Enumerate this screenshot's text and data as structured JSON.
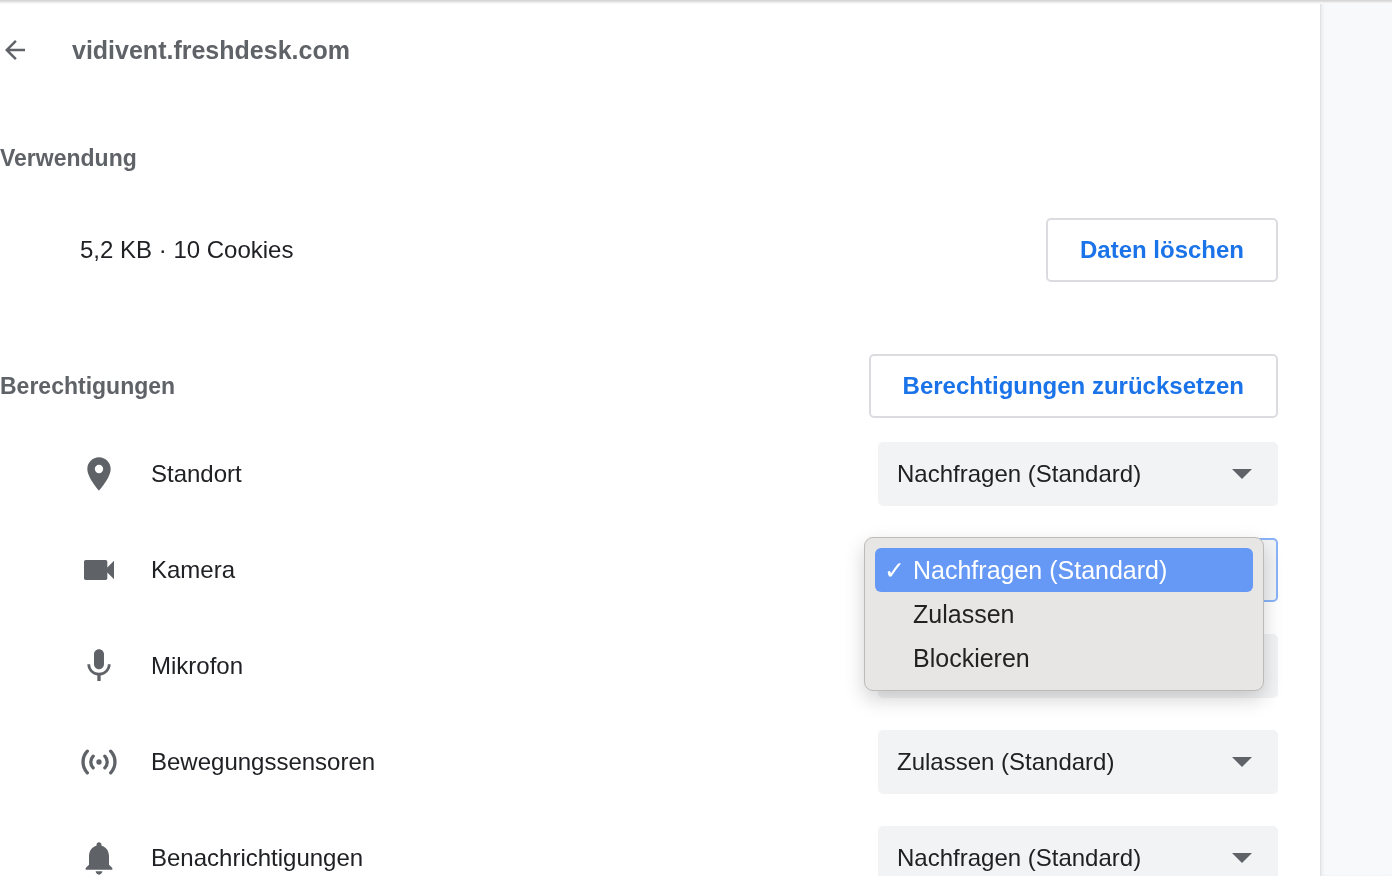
{
  "header": {
    "title": "vidivent.freshdesk.com"
  },
  "usage": {
    "heading": "Verwendung",
    "summary": "5,2 KB · 10 Cookies",
    "button": "Daten löschen"
  },
  "permissions": {
    "heading": "Berechtigungen",
    "reset_button": "Berechtigungen zurücksetzen",
    "items": [
      {
        "kind": "location",
        "label": "Standort",
        "value": "Nachfragen (Standard)",
        "focused": false
      },
      {
        "kind": "camera",
        "label": "Kamera",
        "focused": true
      },
      {
        "kind": "microphone",
        "label": "Mikrofon",
        "focused": false
      },
      {
        "kind": "sensors",
        "label": "Bewegungssensoren",
        "value": "Zulassen (Standard)",
        "focused": false
      },
      {
        "kind": "notifications",
        "label": "Benachrichtigungen",
        "value": "Nachfragen (Standard)",
        "focused": false
      }
    ]
  },
  "dropdown_menu": {
    "options": [
      {
        "label": "Nachfragen (Standard)",
        "check": "✓",
        "selected": true
      },
      {
        "label": "Zulassen",
        "selected": false
      },
      {
        "label": "Blockieren",
        "selected": false
      }
    ]
  }
}
